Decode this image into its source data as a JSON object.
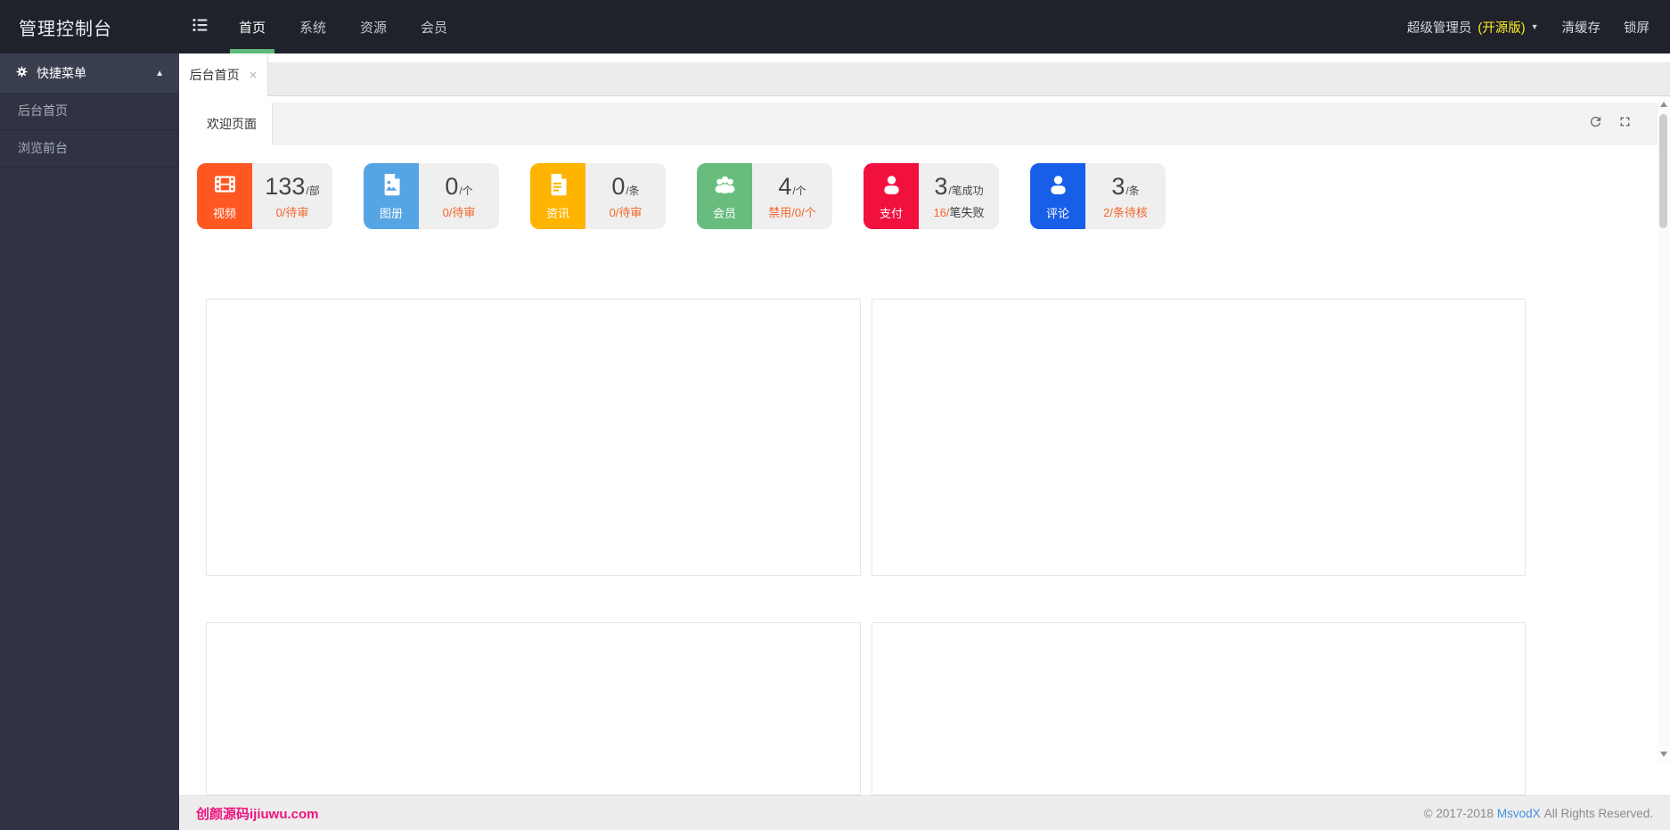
{
  "theme": {
    "accent_green": "#5FB878",
    "warn_orange": "#F2662D",
    "edition_yellow": "#FFED21",
    "brand_pink": "#ED147F",
    "link_blue": "#4493DD"
  },
  "icons": {
    "caret_up": "▲",
    "caret_down": "▼",
    "close": "×"
  },
  "navbar": {
    "title": "管理控制台",
    "menu_icon": "list-icon",
    "items": [
      {
        "label": "首页",
        "active": true
      },
      {
        "label": "系统",
        "active": false
      },
      {
        "label": "资源",
        "active": false
      },
      {
        "label": "会员",
        "active": false
      }
    ],
    "user": "超级管理员",
    "edition": "(开源版)",
    "actions": [
      {
        "label": "清缓存"
      },
      {
        "label": "锁屏"
      }
    ]
  },
  "sidebar": {
    "header": {
      "icon": "gear-icon",
      "label": "快捷菜单"
    },
    "items": [
      {
        "label": "后台首页"
      },
      {
        "label": "浏览前台"
      }
    ]
  },
  "tabbar": {
    "tabs": [
      {
        "label": "后台首页",
        "active": true,
        "closable": true
      }
    ]
  },
  "welcome": {
    "tab_label": "欢迎页面",
    "tools": [
      "refresh-icon",
      "fullscreen-icon"
    ]
  },
  "stats": [
    {
      "icon": "film-icon",
      "color": "#FF5722",
      "label": "视频",
      "value": "133",
      "unit": "/部",
      "sub_em": "0/待审",
      "sub_rest": ""
    },
    {
      "icon": "photo-icon",
      "color": "#55A4E4",
      "label": "图册",
      "value": "0",
      "unit": "/个",
      "sub_em": "0/待审",
      "sub_rest": ""
    },
    {
      "icon": "doc-icon",
      "color": "#FFB401",
      "label": "资讯",
      "value": "0",
      "unit": "/条",
      "sub_em": "0/待审",
      "sub_rest": ""
    },
    {
      "icon": "users-icon",
      "color": "#68BD7E",
      "label": "会员",
      "value": "4",
      "unit": "/个",
      "sub_em": "禁用/0/个",
      "sub_rest": ""
    },
    {
      "icon": "user-icon",
      "color": "#F2103F",
      "label": "支付",
      "value": "3",
      "unit": "/笔成功",
      "sub_em": "16/",
      "sub_rest": "笔失败"
    },
    {
      "icon": "user-icon",
      "color": "#175FE8",
      "label": "评论",
      "value": "3",
      "unit": "/条",
      "sub_em": "2/条待核",
      "sub_rest": ""
    }
  ],
  "footer": {
    "site": "创颜源码ijiuwu.com",
    "copyright_prefix": "© 2017-2018",
    "brand": "MsvodX",
    "copyright_suffix": "All Rights Reserved."
  }
}
